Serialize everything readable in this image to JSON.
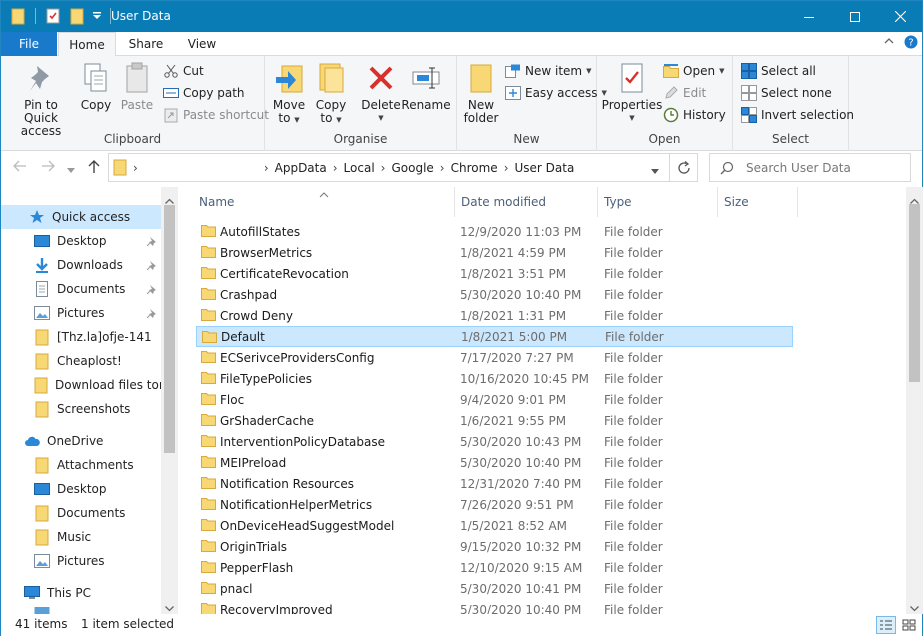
{
  "window": {
    "title": "User Data"
  },
  "tabs": {
    "file": "File",
    "home": "Home",
    "share": "Share",
    "view": "View"
  },
  "ribbon": {
    "clipboard": {
      "label": "Clipboard",
      "pin_l1": "Pin to Quick",
      "pin_l2": "access",
      "copy": "Copy",
      "paste": "Paste",
      "cut": "Cut",
      "copy_path": "Copy path",
      "paste_shortcut": "Paste shortcut"
    },
    "organise": {
      "label": "Organise",
      "move_l1": "Move",
      "move_l2": "to",
      "copy_l1": "Copy",
      "copy_l2": "to",
      "delete": "Delete",
      "rename": "Rename"
    },
    "new": {
      "label": "New",
      "folder_l1": "New",
      "folder_l2": "folder",
      "new_item": "New item",
      "easy_access": "Easy access"
    },
    "open": {
      "label": "Open",
      "properties": "Properties",
      "open": "Open",
      "edit": "Edit",
      "history": "History"
    },
    "select": {
      "label": "Select",
      "select_all": "Select all",
      "select_none": "Select none",
      "invert": "Invert selection"
    }
  },
  "address": {
    "crumbs": [
      "AppData",
      "Local",
      "Google",
      "Chrome",
      "User Data"
    ],
    "search_placeholder": "Search User Data"
  },
  "navpane": {
    "quick_access": "Quick access",
    "quick_items": [
      "Desktop",
      "Downloads",
      "Documents",
      "Pictures",
      "[Thz.la]ofje-141",
      "Cheaplost!",
      "Download files torre",
      "Screenshots"
    ],
    "onedrive": "OneDrive",
    "onedrive_items": [
      "Attachments",
      "Desktop",
      "Documents",
      "Music",
      "Pictures"
    ],
    "this_pc": "This PC"
  },
  "columns": {
    "name": "Name",
    "date": "Date modified",
    "type": "Type",
    "size": "Size"
  },
  "files": [
    {
      "name": "AutofillStates",
      "date": "12/9/2020 11:03 PM",
      "type": "File folder"
    },
    {
      "name": "BrowserMetrics",
      "date": "1/8/2021 4:59 PM",
      "type": "File folder"
    },
    {
      "name": "CertificateRevocation",
      "date": "1/8/2021 3:51 PM",
      "type": "File folder"
    },
    {
      "name": "Crashpad",
      "date": "5/30/2020 10:40 PM",
      "type": "File folder"
    },
    {
      "name": "Crowd Deny",
      "date": "1/8/2021 1:31 PM",
      "type": "File folder"
    },
    {
      "name": "Default",
      "date": "1/8/2021 5:00 PM",
      "type": "File folder"
    },
    {
      "name": "ECSerivceProvidersConfig",
      "date": "7/17/2020 7:27 PM",
      "type": "File folder"
    },
    {
      "name": "FileTypePolicies",
      "date": "10/16/2020 10:45 PM",
      "type": "File folder"
    },
    {
      "name": "Floc",
      "date": "9/4/2020 9:01 PM",
      "type": "File folder"
    },
    {
      "name": "GrShaderCache",
      "date": "1/6/2021 9:55 PM",
      "type": "File folder"
    },
    {
      "name": "InterventionPolicyDatabase",
      "date": "5/30/2020 10:43 PM",
      "type": "File folder"
    },
    {
      "name": "MEIPreload",
      "date": "5/30/2020 10:40 PM",
      "type": "File folder"
    },
    {
      "name": "Notification Resources",
      "date": "12/31/2020 7:40 PM",
      "type": "File folder"
    },
    {
      "name": "NotificationHelperMetrics",
      "date": "7/26/2020 9:51 PM",
      "type": "File folder"
    },
    {
      "name": "OnDeviceHeadSuggestModel",
      "date": "1/5/2021 8:52 AM",
      "type": "File folder"
    },
    {
      "name": "OriginTrials",
      "date": "9/15/2020 10:32 PM",
      "type": "File folder"
    },
    {
      "name": "PepperFlash",
      "date": "12/10/2020 9:15 AM",
      "type": "File folder"
    },
    {
      "name": "pnacl",
      "date": "5/30/2020 10:41 PM",
      "type": "File folder"
    },
    {
      "name": "RecoveryImproved",
      "date": "5/30/2020 10:40 PM",
      "type": "File folder"
    }
  ],
  "status": {
    "count": "41 items",
    "selected": "1 item selected"
  },
  "colors": {
    "titlebar": "#0a7cb5",
    "file_tab": "#1979ca",
    "selection": "#cce8ff",
    "folder": "#f8d775"
  }
}
